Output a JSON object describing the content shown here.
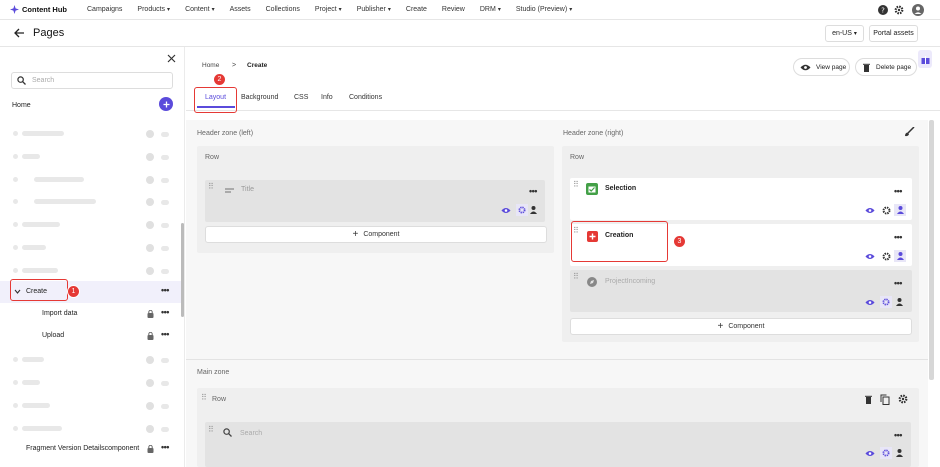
{
  "nav": {
    "brand": "Content Hub",
    "items": [
      {
        "label": "Campaigns",
        "dropdown": false
      },
      {
        "label": "Products",
        "dropdown": true
      },
      {
        "label": "Content",
        "dropdown": true
      },
      {
        "label": "Assets",
        "dropdown": false
      },
      {
        "label": "Collections",
        "dropdown": false
      },
      {
        "label": "Project",
        "dropdown": true
      },
      {
        "label": "Publisher",
        "dropdown": true
      },
      {
        "label": "Create",
        "dropdown": false
      },
      {
        "label": "Review",
        "dropdown": false
      },
      {
        "label": "DRM",
        "dropdown": true
      },
      {
        "label": "Studio (Preview)",
        "dropdown": true
      }
    ],
    "caret": "▾"
  },
  "header": {
    "title": "Pages",
    "locale": "en-US",
    "portal_assets": "Portal assets"
  },
  "sidebar": {
    "search_placeholder": "Search",
    "home": "Home",
    "create": "Create",
    "import_data": "Import data",
    "upload": "Upload",
    "fragment": "Fragment Version Detailscomponent"
  },
  "breadcrumb": {
    "home": "Home",
    "sep": ">",
    "current": "Create"
  },
  "actions": {
    "view_page": "View page",
    "delete_page": "Delete page"
  },
  "tabs": [
    "Layout",
    "Background",
    "CSS",
    "Info",
    "Conditions"
  ],
  "zones": {
    "left": "Header zone (left)",
    "right": "Header zone (right)",
    "main": "Main zone",
    "row": "Row"
  },
  "components": {
    "title": "Title",
    "selection": "Selection",
    "creation": "Creation",
    "projectincoming": "ProjectIncoming",
    "search": "Search",
    "add": "Component",
    "plus": "+"
  },
  "annotations": [
    "1",
    "2",
    "3"
  ],
  "colors": {
    "accent": "#5b4bdb",
    "red": "#e53935",
    "green": "#43a047"
  }
}
